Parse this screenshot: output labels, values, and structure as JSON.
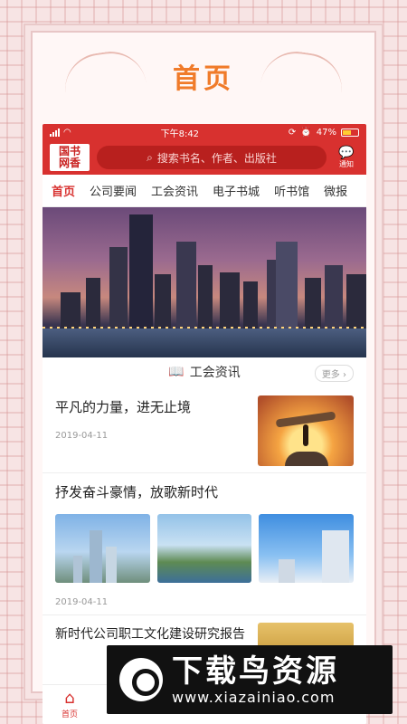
{
  "page": {
    "header_title": "首页"
  },
  "status": {
    "time": "下午8:42",
    "battery": "47%"
  },
  "appbar": {
    "logo_line1": "国书",
    "logo_line2": "网香",
    "search_placeholder": "搜索书名、作者、出版社",
    "notify_label": "通知"
  },
  "tabs": [
    "首页",
    "公司要闻",
    "工会资讯",
    "电子书城",
    "听书馆",
    "微报"
  ],
  "section": {
    "title": "工会资讯",
    "more": "更多"
  },
  "news": [
    {
      "title": "平凡的力量，进无止境",
      "date": "2019-04-11"
    },
    {
      "title": "抒发奋斗豪情，放歌新时代",
      "date": "2019-04-11"
    },
    {
      "title": "新时代公司职工文化建设研究报告"
    }
  ],
  "bottom_nav": {
    "home_label": "首页"
  },
  "watermark": {
    "cn": "下载鸟资源",
    "url": "www.xiazainiao.com"
  },
  "colors": {
    "brand": "#d8312f",
    "title": "#f07b2a"
  }
}
